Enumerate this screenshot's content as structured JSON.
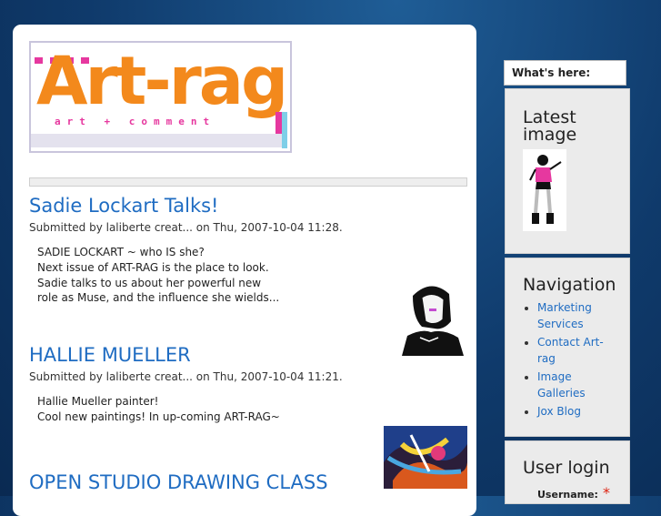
{
  "logo": {
    "word": "Art-rag",
    "tagline": "art + comment"
  },
  "posts": [
    {
      "title": "Sadie Lockart Talks!",
      "meta": "Submitted by laliberte creat... on Thu, 2007-10-04 11:28.",
      "lines": [
        "SADIE LOCKART ~ who IS she?",
        "Next issue of ART-RAG is the place to look.",
        "Sadie talks to us about her powerful new",
        "role as Muse, and the influence she wields..."
      ]
    },
    {
      "title": "HALLIE MUELLER",
      "meta": "Submitted by laliberte creat... on Thu, 2007-10-04 11:21.",
      "lines": [
        "Hallie Mueller painter!",
        "Cool new paintings! In up-coming ART-RAG~"
      ]
    },
    {
      "title": "OPEN STUDIO DRAWING CLASS"
    }
  ],
  "sidebar": {
    "tab_label": "What's here:",
    "latest_image": {
      "title": "Latest image"
    },
    "navigation": {
      "title": "Navigation",
      "items": [
        {
          "label": "Marketing Services"
        },
        {
          "label": "Contact Art-rag"
        },
        {
          "label": "Image Galleries"
        },
        {
          "label": "Jox Blog"
        }
      ]
    },
    "user_login": {
      "title": "User login",
      "username_label": "Username:",
      "required_mark": "*"
    }
  },
  "colors": {
    "link": "#1f6cc2",
    "logo_orange": "#f3891c",
    "logo_pink": "#e6389f",
    "background": "#0f3a6b"
  }
}
